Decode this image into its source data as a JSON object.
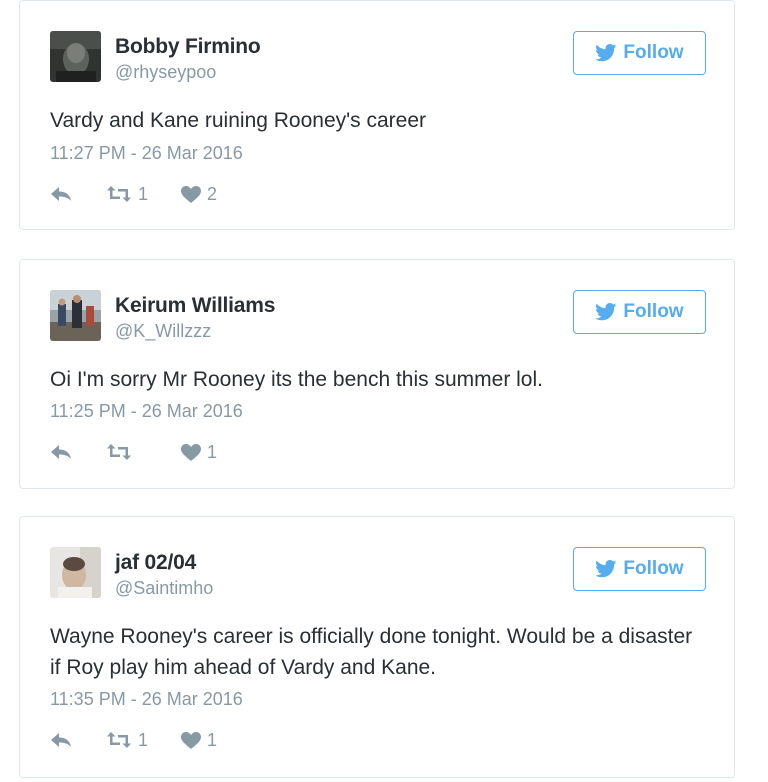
{
  "follow_label": "Follow",
  "colors": {
    "accent": "#55acee",
    "muted": "#8899a6",
    "text": "#292f33",
    "border": "#e1e8ed"
  },
  "tweets": [
    {
      "name": "Bobby Firmino",
      "handle": "@rhyseypoo",
      "text": "Vardy and Kane ruining Rooney's career",
      "time": "11:27 PM - 26 Mar 2016",
      "retweets": "1",
      "likes": "2"
    },
    {
      "name": "Keirum Williams",
      "handle": "@K_Willzzz",
      "text": "Oi I'm sorry Mr Rooney its the bench this summer lol.",
      "time": "11:25 PM - 26 Mar 2016",
      "retweets": "",
      "likes": "1"
    },
    {
      "name": "jaf 02/04",
      "handle": "@Saintimho",
      "text": "Wayne Rooney's career is officially done tonight. Would be a disaster if Roy play him ahead of Vardy and Kane.",
      "time": "11:35 PM - 26 Mar 2016",
      "retweets": "1",
      "likes": "1"
    }
  ]
}
